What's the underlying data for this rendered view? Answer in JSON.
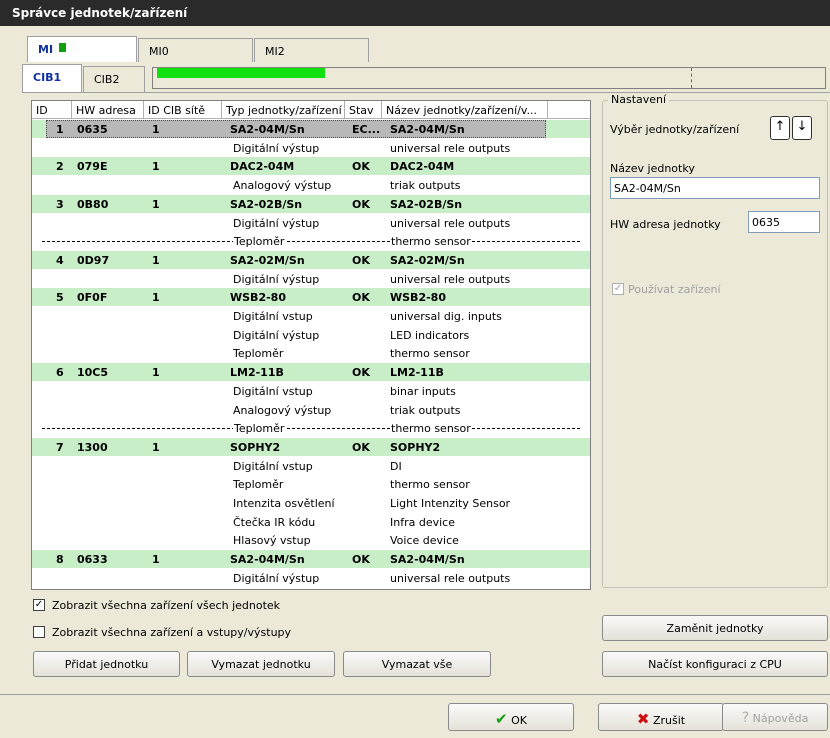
{
  "window": {
    "title": "Správce jednotek/zařízení"
  },
  "tabs_top": [
    {
      "label": "MI",
      "active": true
    },
    {
      "label": "MI0",
      "active": false
    },
    {
      "label": "MI2",
      "active": false
    }
  ],
  "tabs_cib": [
    {
      "label": "CIB1",
      "active": true
    },
    {
      "label": "CIB2",
      "active": false
    }
  ],
  "bus_load": {
    "fill_fraction": 0.25,
    "threshold_fraction": 0.8
  },
  "list": {
    "headers": [
      "ID",
      "HW adresa",
      "ID CIB sítě",
      "Typ jednotky/zařízení",
      "Stav",
      "Název jednotky/zařízení/v..."
    ],
    "rows": [
      {
        "kind": "unit",
        "selected": true,
        "id": "1",
        "hw": "0635",
        "cib": "1",
        "type": "SA2-04M/Sn",
        "state": "EC...",
        "name": "SA2-04M/Sn"
      },
      {
        "kind": "sub",
        "type": "Digitální výstup",
        "name": "universal rele outputs"
      },
      {
        "kind": "unit",
        "id": "2",
        "hw": "079E",
        "cib": "1",
        "type": "DAC2-04M",
        "state": "OK",
        "name": "DAC2-04M"
      },
      {
        "kind": "sub",
        "type": "Analogový výstup",
        "name": "triak outputs"
      },
      {
        "kind": "unit",
        "id": "3",
        "hw": "0B80",
        "cib": "1",
        "type": "SA2-02B/Sn",
        "state": "OK",
        "name": "SA2-02B/Sn"
      },
      {
        "kind": "sub",
        "type": "Digitální výstup",
        "name": "universal rele outputs"
      },
      {
        "kind": "sub",
        "dashed": true,
        "type": "Teploměr",
        "name": "thermo sensor"
      },
      {
        "kind": "unit",
        "id": "4",
        "hw": "0D97",
        "cib": "1",
        "type": "SA2-02M/Sn",
        "state": "OK",
        "name": "SA2-02M/Sn"
      },
      {
        "kind": "sub",
        "type": "Digitální výstup",
        "name": "universal rele outputs"
      },
      {
        "kind": "unit",
        "id": "5",
        "hw": "0F0F",
        "cib": "1",
        "type": "WSB2-80",
        "state": "OK",
        "name": "WSB2-80"
      },
      {
        "kind": "sub",
        "type": "Digitální vstup",
        "name": "universal dig. inputs"
      },
      {
        "kind": "sub",
        "type": "Digitální výstup",
        "name": "LED indicators"
      },
      {
        "kind": "sub",
        "type": "Teploměr",
        "name": "thermo sensor"
      },
      {
        "kind": "unit",
        "id": "6",
        "hw": "10C5",
        "cib": "1",
        "type": "LM2-11B",
        "state": "OK",
        "name": "LM2-11B"
      },
      {
        "kind": "sub",
        "type": "Digitální vstup",
        "name": "binar inputs"
      },
      {
        "kind": "sub",
        "type": "Analogový výstup",
        "name": "triak outputs"
      },
      {
        "kind": "sub",
        "dashed": true,
        "type": "Teploměr",
        "name": "thermo sensor"
      },
      {
        "kind": "unit",
        "id": "7",
        "hw": "1300",
        "cib": "1",
        "type": "SOPHY2",
        "state": "OK",
        "name": "SOPHY2"
      },
      {
        "kind": "sub",
        "type": "Digitální vstup",
        "name": "DI"
      },
      {
        "kind": "sub",
        "type": "Teploměr",
        "name": "thermo sensor"
      },
      {
        "kind": "sub",
        "type": "Intenzita osvětlení",
        "name": "Light Intenzity Sensor"
      },
      {
        "kind": "sub",
        "type": "Čtečka IR kódu",
        "name": "Infra device"
      },
      {
        "kind": "sub",
        "type": "Hlasový vstup",
        "name": "Voice device"
      },
      {
        "kind": "unit",
        "id": "8",
        "hw": "0633",
        "cib": "1",
        "type": "SA2-04M/Sn",
        "state": "OK",
        "name": "SA2-04M/Sn"
      },
      {
        "kind": "sub",
        "type": "Digitální výstup",
        "name": "universal rele outputs"
      }
    ]
  },
  "options": {
    "show_all_devices": {
      "label": "Zobrazit všechna zařízení všech jednotek",
      "checked": true
    },
    "show_all_io": {
      "label": "Zobrazit všechna zařízení a vstupy/výstupy",
      "checked": false
    }
  },
  "buttons": {
    "add_unit": "Přidat jednotku",
    "delete_unit": "Vymazat jednotku",
    "delete_all": "Vymazat vše",
    "swap_units": "Zaměnit jednotky",
    "load_config": "Načíst konfiguraci z CPU",
    "ok": "OK",
    "cancel": "Zrušit",
    "help": "Nápověda"
  },
  "settings": {
    "legend": "Nastavení",
    "select_label": "Výběr jednotky/zařízení",
    "up_arrow": "↑",
    "down_arrow": "↓",
    "name_label": "Název jednotky",
    "name_value": "SA2-04M/Sn",
    "hw_label": "HW adresa jednotky",
    "hw_value": "0635",
    "use_device_label": "Používat zařízení",
    "use_device_checked": true
  }
}
